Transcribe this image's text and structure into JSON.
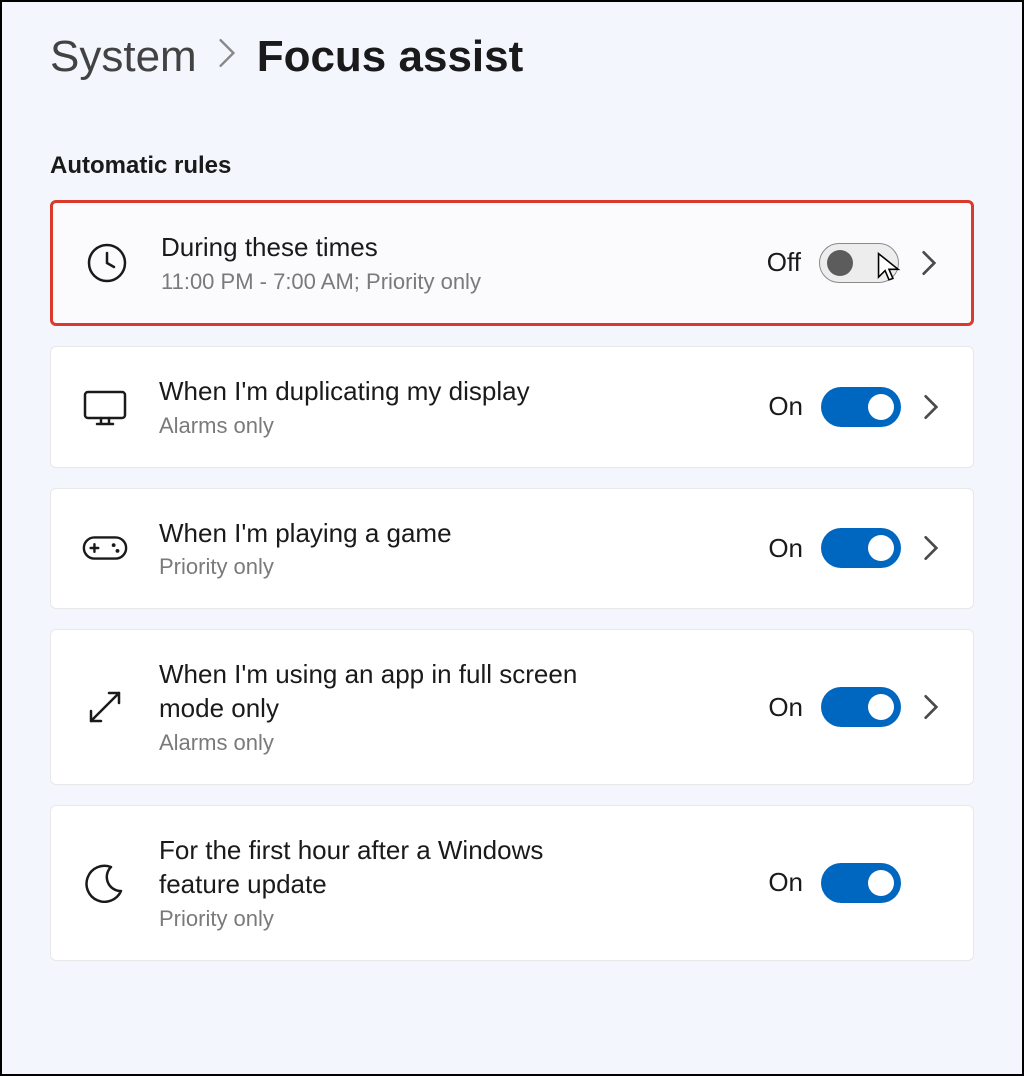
{
  "breadcrumb": {
    "parent": "System",
    "current": "Focus assist"
  },
  "section_header": "Automatic rules",
  "toggle_states": {
    "on_label": "On",
    "off_label": "Off"
  },
  "rules": [
    {
      "id": "during-times",
      "icon": "clock-icon",
      "title": "During these times",
      "subtitle": "11:00 PM - 7:00 AM; Priority only",
      "state": "Off",
      "on": false,
      "has_chevron": true,
      "highlighted": true,
      "cursor_shown": true
    },
    {
      "id": "duplicating-display",
      "icon": "monitor-icon",
      "title": "When I'm duplicating my display",
      "subtitle": "Alarms only",
      "state": "On",
      "on": true,
      "has_chevron": true,
      "highlighted": false
    },
    {
      "id": "playing-game",
      "icon": "gamepad-icon",
      "title": "When I'm playing a game",
      "subtitle": "Priority only",
      "state": "On",
      "on": true,
      "has_chevron": true,
      "highlighted": false
    },
    {
      "id": "fullscreen-app",
      "icon": "fullscreen-icon",
      "title": "When I'm using an app in full screen mode only",
      "subtitle": "Alarms only",
      "state": "On",
      "on": true,
      "has_chevron": true,
      "highlighted": false
    },
    {
      "id": "after-update",
      "icon": "moon-icon",
      "title": "For the first hour after a Windows feature update",
      "subtitle": "Priority only",
      "state": "On",
      "on": true,
      "has_chevron": false,
      "highlighted": false
    }
  ]
}
